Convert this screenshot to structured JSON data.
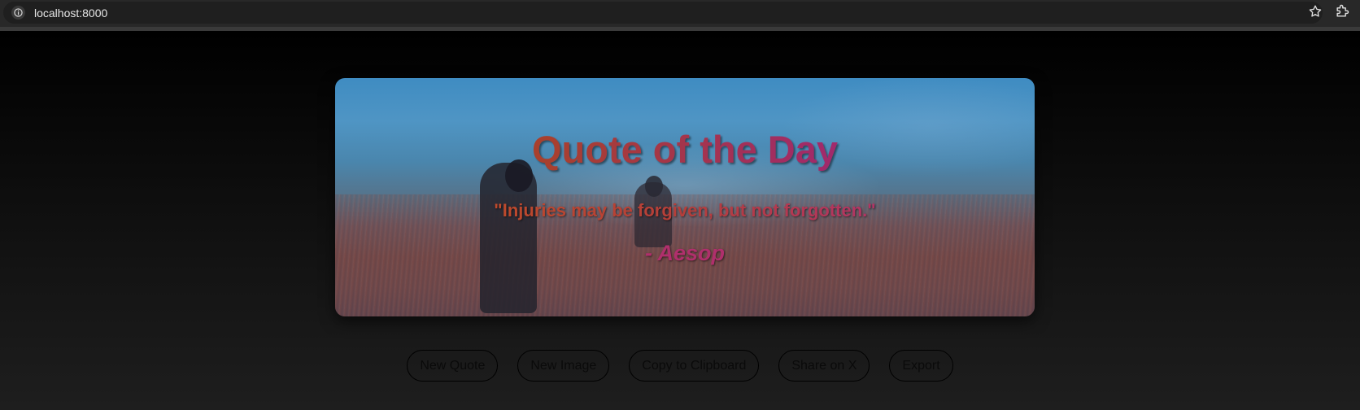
{
  "browser": {
    "url": "localhost:8000",
    "icons": [
      "info-icon",
      "star-icon",
      "extensions-icon"
    ]
  },
  "card": {
    "title": "Quote of the Day",
    "quote": "\"Injuries may be forgiven, but not forgotten.\"",
    "author": "- Aesop"
  },
  "buttons": {
    "new_quote": "New Quote",
    "new_image": "New Image",
    "copy": "Copy to Clipboard",
    "share": "Share on X",
    "export": "Export"
  },
  "colors": {
    "title_start": "#b0451e",
    "title_end": "#a0288a",
    "author": "#b02f6c"
  }
}
